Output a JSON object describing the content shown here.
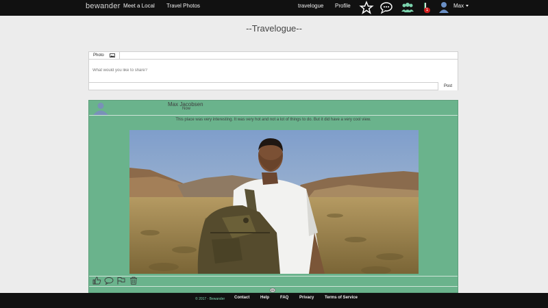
{
  "nav": {
    "brand": "bewander",
    "left_links": [
      "Meet a Local",
      "Travel Photos"
    ],
    "right_links": [
      "travelogue",
      "Profile"
    ],
    "icons": [
      "star-icon",
      "chat-icon",
      "group-icon",
      "notification-icon"
    ],
    "notification_count": "1",
    "user": "Max"
  },
  "page": {
    "title": "--Travelogue--"
  },
  "composer": {
    "photo_tab": "Photo",
    "placeholder": "What would you like to share?",
    "post_button": "Post"
  },
  "post": {
    "author": "Max Jacobsen",
    "time": "Now",
    "text": "This place was very interesting. It was very hot and not a lot of things to do. But it did have a very cool view.",
    "actions": [
      "like-icon",
      "comment-icon",
      "flag-icon",
      "trash-icon"
    ]
  },
  "footer": {
    "copyright": "© 2017 - Bewander",
    "links": [
      "Contact",
      "Help",
      "FAQ",
      "Privacy",
      "Terms of Service"
    ]
  },
  "colors": {
    "nav_bg": "#111111",
    "post_bg": "#6ab38c",
    "accent": "#7bd3ad",
    "badge": "#d21e1e"
  }
}
